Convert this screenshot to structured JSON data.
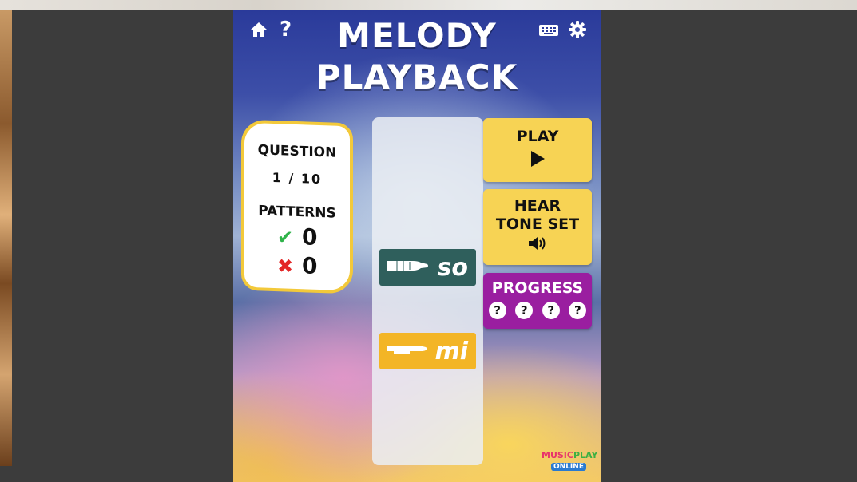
{
  "title": {
    "line1": "MELODY",
    "line2": "PLAYBACK"
  },
  "toolbar": {
    "home_icon": "home-icon",
    "help_label": "?",
    "keyboard_icon": "keyboard-icon",
    "settings_icon": "gear-icon"
  },
  "scorecard": {
    "question_label": "QUESTION",
    "question_value": "1 / 10",
    "patterns_label": "PATTERNS",
    "correct_count": "0",
    "wrong_count": "0"
  },
  "notes": [
    {
      "syllable": "so",
      "color": "#2f5f5c"
    },
    {
      "syllable": "mi",
      "color": "#f3b526"
    }
  ],
  "buttons": {
    "play_label": "PLAY",
    "hear_line1": "HEAR",
    "hear_line2": "TONE SET"
  },
  "progress": {
    "label": "PROGRESS",
    "marks": [
      "?",
      "?",
      "?",
      "?"
    ]
  },
  "brand": {
    "line1a": "MUSIC",
    "line1b": "PLAY",
    "line2": "ONLINE"
  },
  "colors": {
    "accent_yellow": "#f7d354",
    "progress_purple": "#9a1ea0",
    "card_border": "#f3c93a"
  }
}
